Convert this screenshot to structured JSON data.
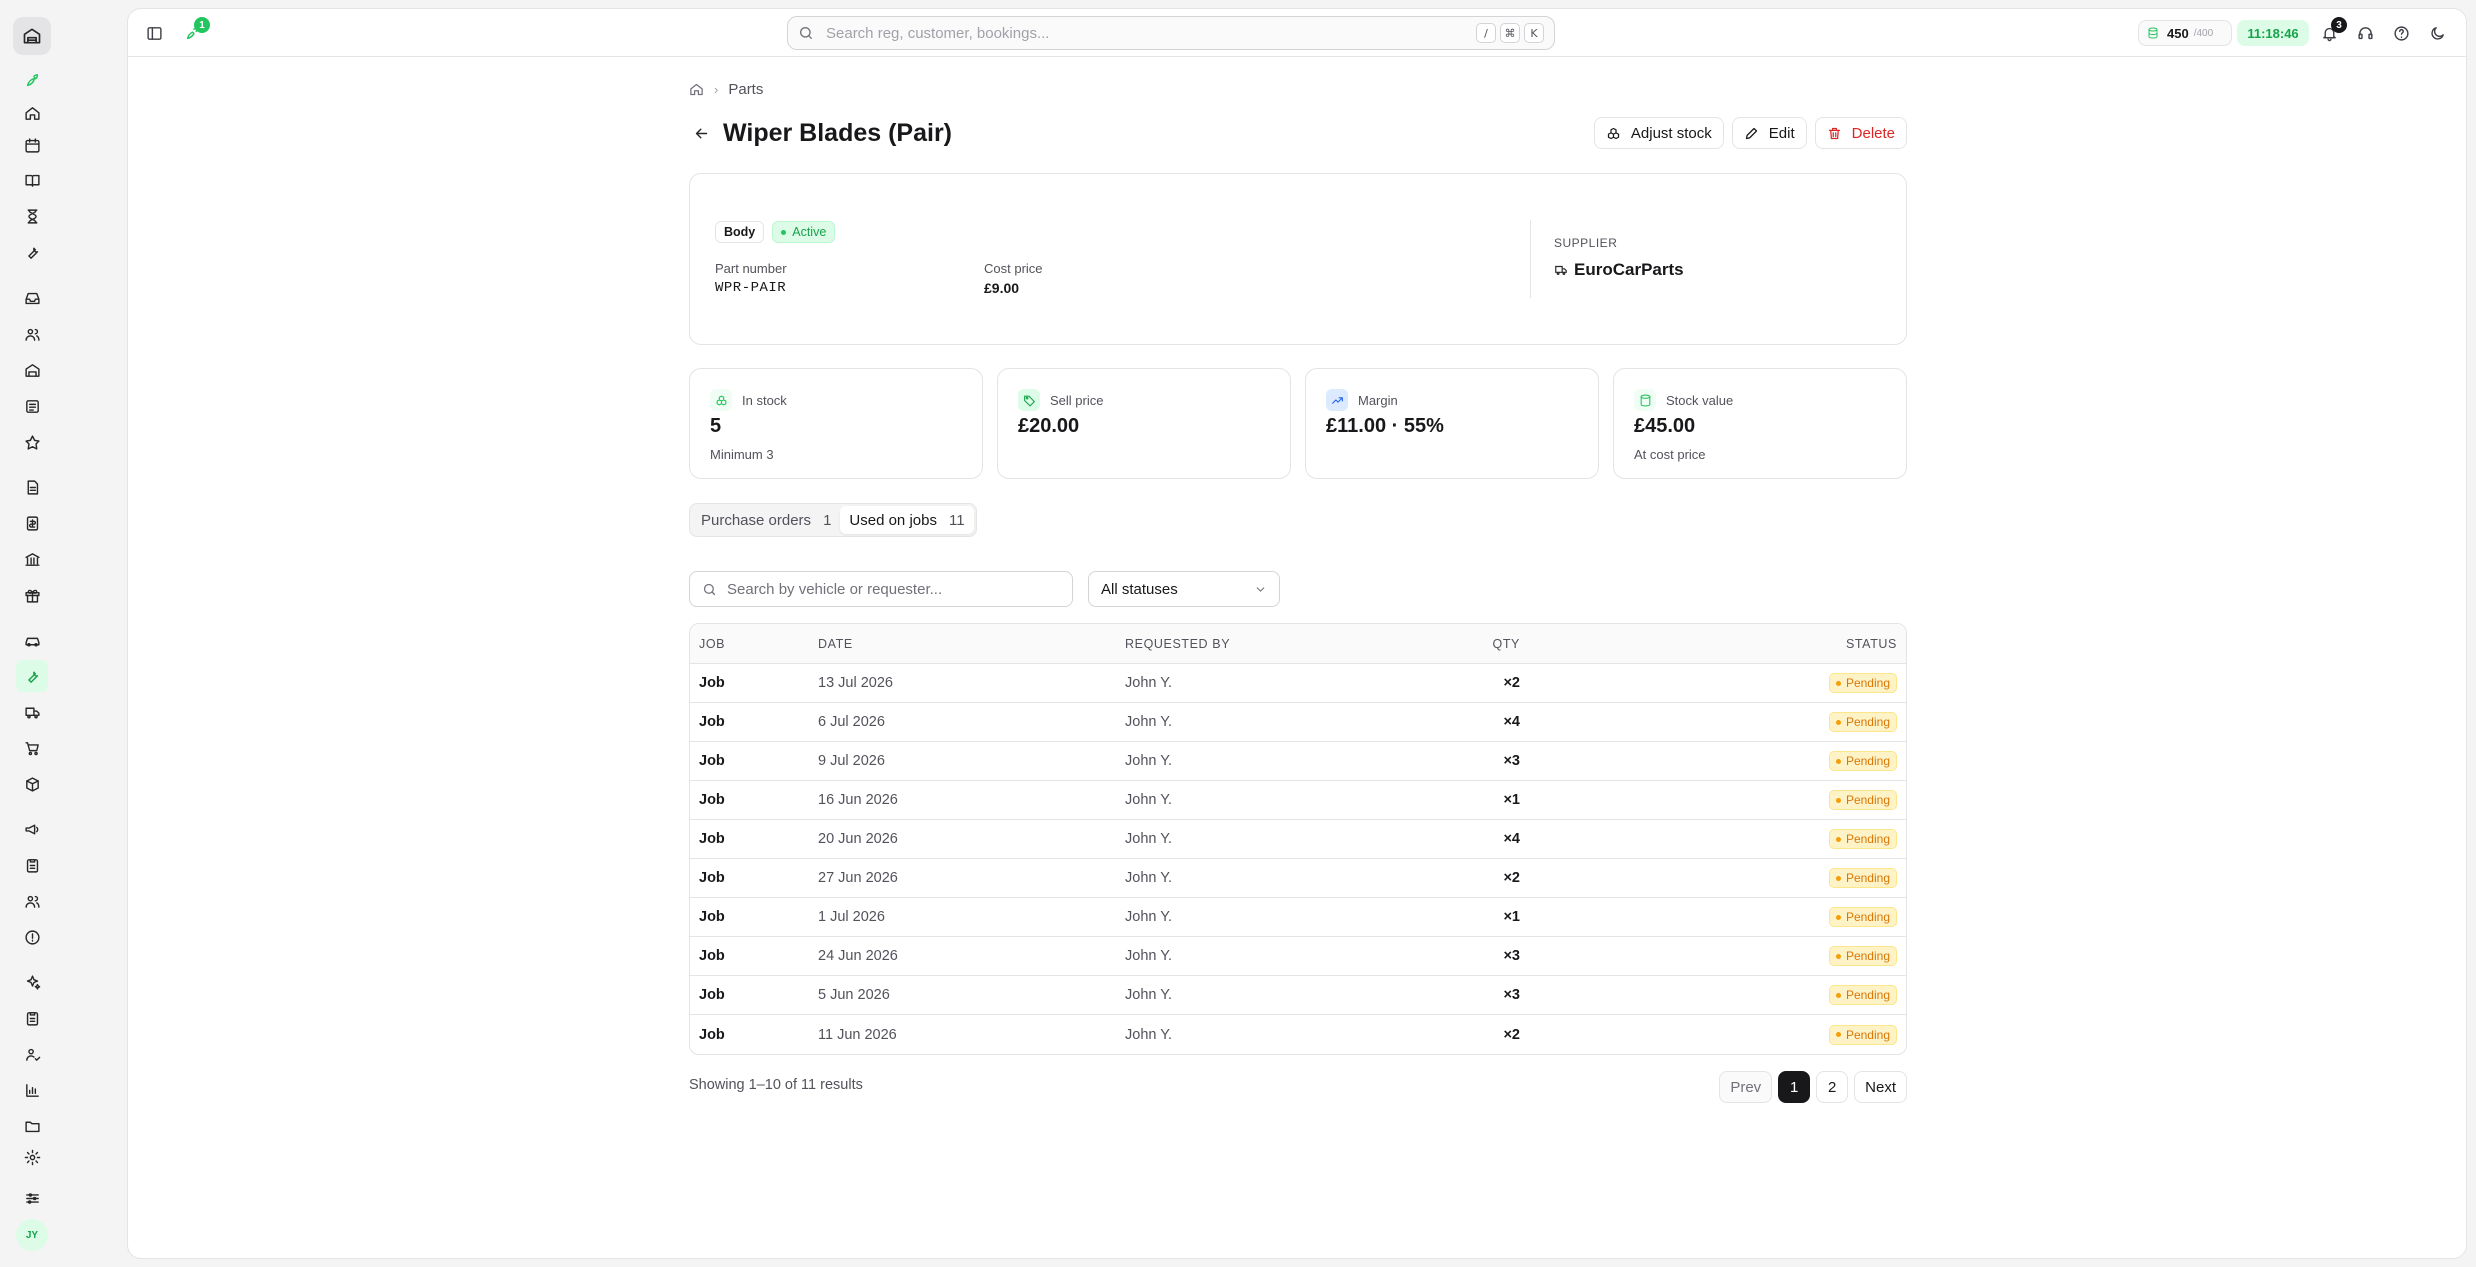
{
  "topbar": {
    "search_placeholder": "Search reg, customer, bookings...",
    "shortcut_keys": [
      "/",
      "⌘",
      "K"
    ],
    "credits": "450",
    "credits_max": "/400",
    "clock": "11:18:46",
    "rocket_badge": "1",
    "notifications_badge": "3"
  },
  "breadcrumb": {
    "parent": "Parts"
  },
  "page": {
    "title": "Wiper Blades (Pair)",
    "actions": {
      "adjust_stock": "Adjust stock",
      "edit": "Edit",
      "delete": "Delete"
    }
  },
  "part": {
    "category": "Body",
    "status": "Active",
    "part_number_label": "Part number",
    "part_number": "WPR-PAIR",
    "cost_price_label": "Cost price",
    "cost_price": "£9.00",
    "supplier_label": "SUPPLIER",
    "supplier": "EuroCarParts"
  },
  "stats": [
    {
      "label": "In stock",
      "value": "5",
      "sub": "Minimum 3",
      "icon": "boxes-icon"
    },
    {
      "label": "Sell price",
      "value": "£20.00",
      "sub": "",
      "icon": "tag-icon"
    },
    {
      "label": "Margin",
      "value": "£11.00 · 55%",
      "sub": "",
      "icon": "trending-up-icon"
    },
    {
      "label": "Stock value",
      "value": "£45.00",
      "sub": "At cost price",
      "icon": "database-icon"
    }
  ],
  "tabs": [
    {
      "label": "Purchase orders",
      "count": "1"
    },
    {
      "label": "Used on jobs",
      "count": "11"
    }
  ],
  "filters": {
    "search_placeholder": "Search by vehicle or requester...",
    "status_select": "All statuses"
  },
  "table": {
    "headers": {
      "job": "JOB",
      "date": "DATE",
      "requested_by": "REQUESTED BY",
      "qty": "QTY",
      "status": "STATUS"
    },
    "rows": [
      {
        "job": "Job",
        "date": "13 Jul 2026",
        "requested_by": "John Y.",
        "qty": "×2",
        "status": "Pending"
      },
      {
        "job": "Job",
        "date": "6 Jul 2026",
        "requested_by": "John Y.",
        "qty": "×4",
        "status": "Pending"
      },
      {
        "job": "Job",
        "date": "9 Jul 2026",
        "requested_by": "John Y.",
        "qty": "×3",
        "status": "Pending"
      },
      {
        "job": "Job",
        "date": "16 Jun 2026",
        "requested_by": "John Y.",
        "qty": "×1",
        "status": "Pending"
      },
      {
        "job": "Job",
        "date": "20 Jun 2026",
        "requested_by": "John Y.",
        "qty": "×4",
        "status": "Pending"
      },
      {
        "job": "Job",
        "date": "27 Jun 2026",
        "requested_by": "John Y.",
        "qty": "×2",
        "status": "Pending"
      },
      {
        "job": "Job",
        "date": "1 Jul 2026",
        "requested_by": "John Y.",
        "qty": "×1",
        "status": "Pending"
      },
      {
        "job": "Job",
        "date": "24 Jun 2026",
        "requested_by": "John Y.",
        "qty": "×3",
        "status": "Pending"
      },
      {
        "job": "Job",
        "date": "5 Jun 2026",
        "requested_by": "John Y.",
        "qty": "×3",
        "status": "Pending"
      },
      {
        "job": "Job",
        "date": "11 Jun 2026",
        "requested_by": "John Y.",
        "qty": "×2",
        "status": "Pending"
      }
    ]
  },
  "pagination": {
    "summary": "Showing 1–10 of 11 results",
    "prev": "Prev",
    "pages": [
      "1",
      "2"
    ],
    "next": "Next"
  },
  "user": {
    "initials": "JY"
  },
  "colors": {
    "accent": "#22c55e",
    "pending": "#d97706",
    "danger": "#dc2626"
  }
}
